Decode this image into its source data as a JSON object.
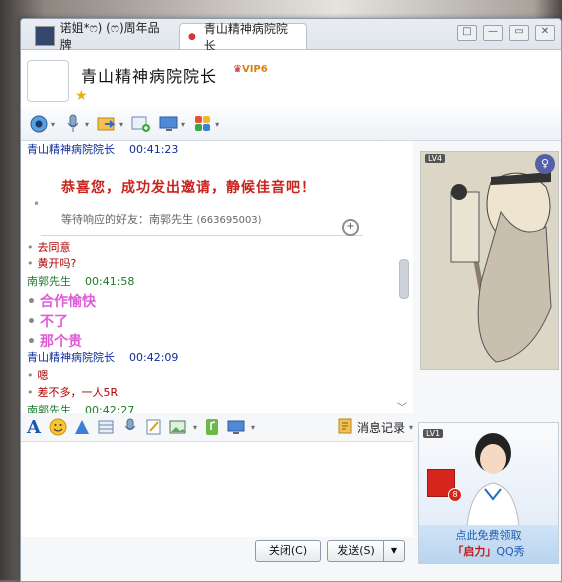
{
  "tabs": [
    {
      "label": "诺姐*ෆ) (ෆ)周年品牌"
    },
    {
      "label": "青山精神病院院长"
    }
  ],
  "window_buttons": [
    "□",
    "—",
    "▭",
    "✕"
  ],
  "header": {
    "contact_name": "青山精神病院院长",
    "vip_label": "VIP6"
  },
  "chat": {
    "m1_sender": "青山精神病院院长",
    "m1_time": "00:41:23",
    "invite_title": "恭喜您，成功发出邀请，静候佳音吧！",
    "invite_wait": "等待响应的好友：南郭先生",
    "invite_id": "(663695003)",
    "r1": "去同意",
    "r2": "黄开吗?",
    "m2_sender": "南郭先生",
    "m2_time": "00:41:58",
    "p1": "合作愉快",
    "p2": "不了",
    "p3": "那个贵",
    "m3_sender": "青山精神病院院长",
    "m3_time": "00:42:09",
    "r3": "嗯",
    "r4": "差不多，一人5R",
    "m4_sender": "南郭先生",
    "m4_time": "00:42:27"
  },
  "format_bar": {
    "history_label": "消息记录"
  },
  "buttons": {
    "close": "关闭(C)",
    "send": "发送(S)"
  },
  "show_panels": {
    "top_level": "LV4",
    "bottom_level": "LV1",
    "gift_count": "8",
    "banner_line1": "点此免费领取",
    "banner_brand": "「启力」",
    "banner_qq": "QQ秀"
  }
}
